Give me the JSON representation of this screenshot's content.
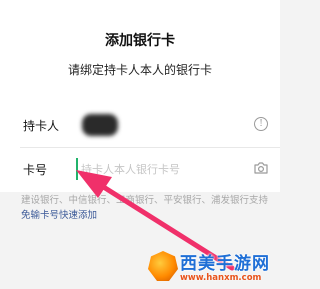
{
  "header": {
    "title": "添加银行卡",
    "subtitle": "请绑定持卡人本人的银行卡"
  },
  "form": {
    "holder_label": "持卡人",
    "holder_info_icon": "info-icon",
    "card_label": "卡号",
    "card_placeholder": "持卡人本人银行卡号",
    "card_value": "",
    "camera_icon": "camera-icon"
  },
  "hint": {
    "text": "建设银行、中信银行、工商银行、平安银行、浦发银行支持",
    "link": "免输卡号快速添加"
  },
  "annotation": {
    "arrow_color": "#f0306a"
  },
  "watermark": {
    "name": "西美手游网",
    "url": "www.hanxm.com"
  }
}
